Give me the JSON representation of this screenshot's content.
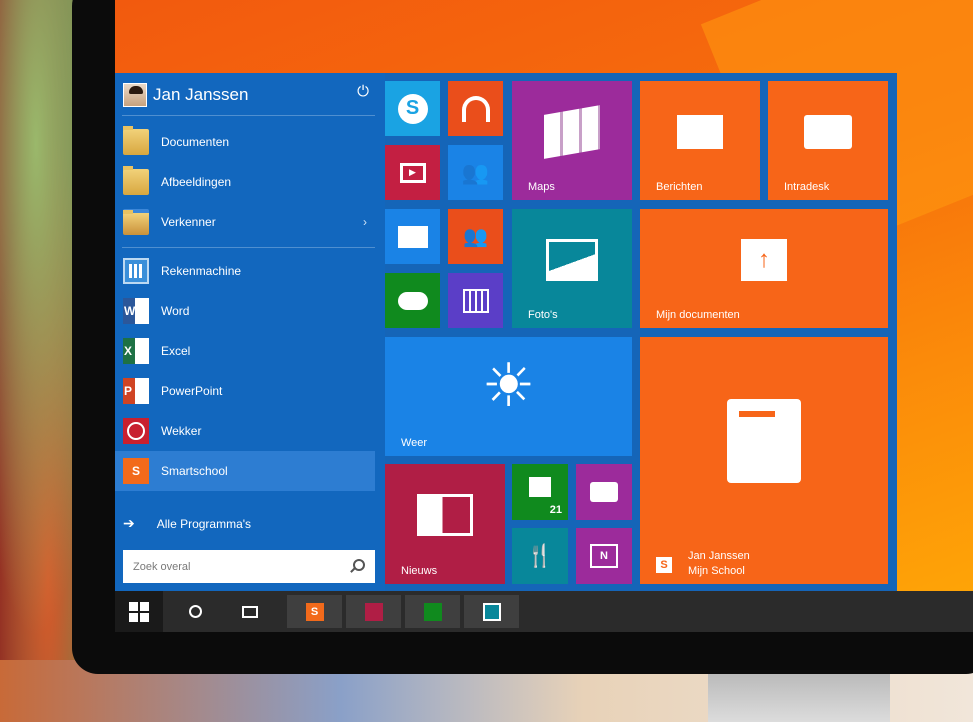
{
  "user": {
    "name": "Jan Janssen"
  },
  "menu": {
    "places": [
      {
        "label": "Documenten",
        "icon": "folder-icon"
      },
      {
        "label": "Afbeeldingen",
        "icon": "pictures-folder-icon"
      },
      {
        "label": "Verkenner",
        "icon": "file-explorer-icon",
        "chevron": "›"
      }
    ],
    "apps": [
      {
        "label": "Rekenmachine",
        "icon": "calculator-icon"
      },
      {
        "label": "Word",
        "icon": "word-icon",
        "badge": "W"
      },
      {
        "label": "Excel",
        "icon": "excel-icon",
        "badge": "X"
      },
      {
        "label": "PowerPoint",
        "icon": "powerpoint-icon",
        "badge": "P"
      },
      {
        "label": "Wekker",
        "icon": "alarm-clock-icon"
      },
      {
        "label": "Smartschool",
        "icon": "smartschool-icon",
        "badge": "S"
      }
    ],
    "all_programs": "Alle Programma's",
    "search_placeholder": "Zoek overal"
  },
  "tiles": {
    "maps": "Maps",
    "berichten": "Berichten",
    "intradesk": "Intradesk",
    "fotos": "Foto's",
    "mijn_documenten": "Mijn documenten",
    "weer": "Weer",
    "nieuws": "Nieuws",
    "store_count": "21",
    "school_user": "Jan Janssen",
    "school_name": "Mijn School",
    "school_badge": "S"
  },
  "taskbar": {
    "smartschool_badge": "S"
  },
  "colors": {
    "startmenu": "#1565b8",
    "accent_orange": "#f76518",
    "magenta": "#9c2b9b",
    "teal": "#08879a",
    "green": "#108a1e",
    "crimson": "#b01e45",
    "taskbar": "#2b2b2b"
  }
}
